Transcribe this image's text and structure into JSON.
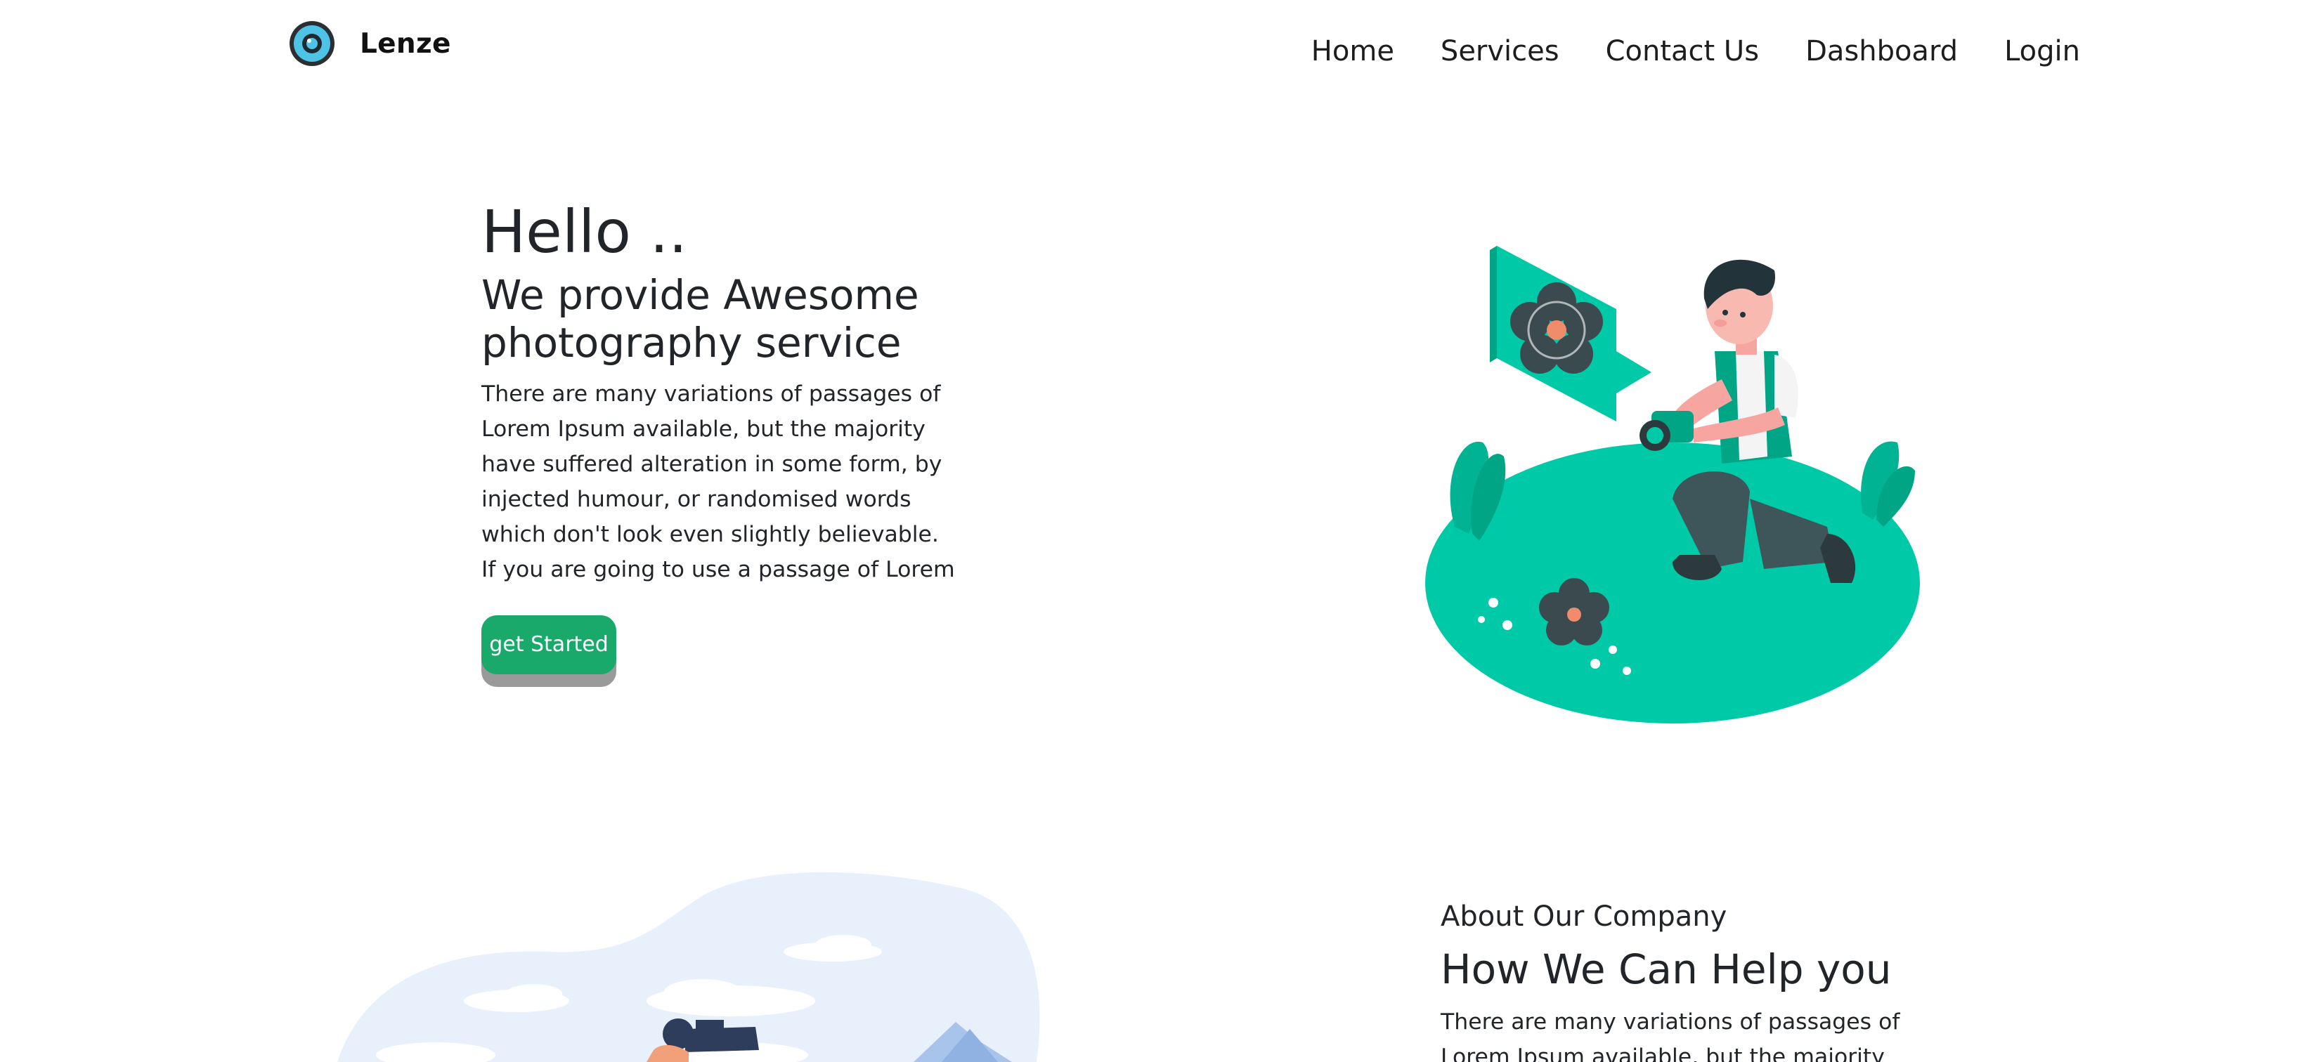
{
  "brand": {
    "name": "Lenze",
    "logo_icon": "camera-lens-icon"
  },
  "nav": {
    "items": [
      {
        "label": "Home"
      },
      {
        "label": "Services"
      },
      {
        "label": "Contact Us"
      },
      {
        "label": "Dashboard"
      },
      {
        "label": "Login"
      }
    ]
  },
  "hero": {
    "greeting": "Hello ..",
    "headline": "We provide Awesome photography service",
    "paragraph": "There are many variations of passages of Lorem Ipsum available, but the majority have suffered alteration in some form, by injected humour, or randomised words which don't look even slightly believable. If you are going to use a passage of Lorem",
    "cta_label": "get Started",
    "illustration_icon": "photographer-kneeling-illustration"
  },
  "about": {
    "kicker": "About Our Company",
    "title": "How We Can Help you",
    "paragraph": "There are many variations of passages of Lorem Ipsum available, but the majority have",
    "illustration_icon": "photographer-mountains-illustration"
  },
  "colors": {
    "accent_green": "#18a96b",
    "illustration_teal": "#00c9a7",
    "button_shadow": "#9a9a9a",
    "text": "#212529",
    "sky_blue": "#e8f0fb"
  }
}
